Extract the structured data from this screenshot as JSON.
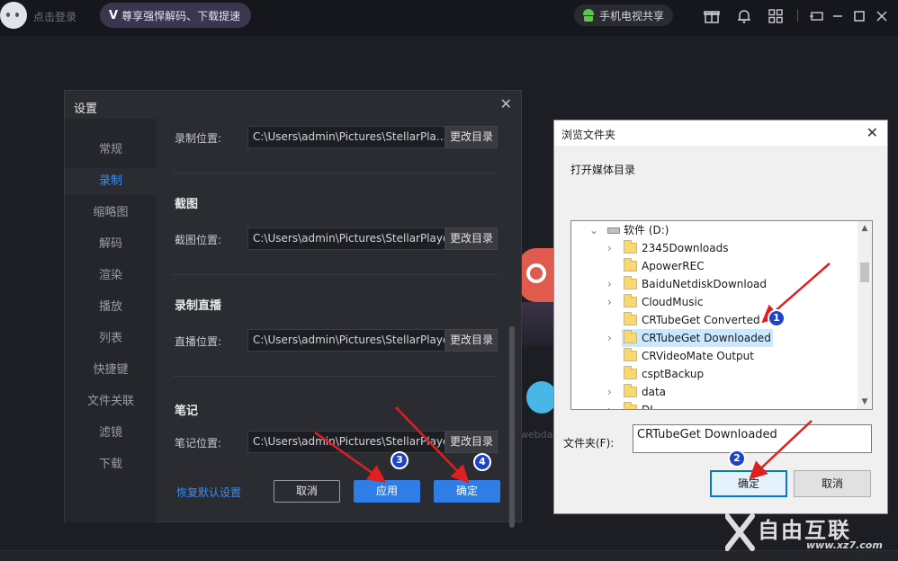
{
  "topbar": {
    "login": "点击登录",
    "vip_prefix": "V",
    "vip_text": "尊享强悍解码、下载提速",
    "share": "手机电视共享"
  },
  "background": {
    "partial_text": "webda"
  },
  "settings": {
    "title": "设置",
    "sidebar": [
      "常规",
      "录制",
      "缩略图",
      "解码",
      "渲染",
      "播放",
      "列表",
      "快捷键",
      "文件关联",
      "滤镜",
      "下载"
    ],
    "active_index": 1,
    "record_label": "录制位置:",
    "record_path": "C:\\Users\\admin\\Pictures\\StellarPla...",
    "screenshot_title": "截图",
    "screenshot_label": "截图位置:",
    "screenshot_path": "C:\\Users\\admin\\Pictures\\StellarPlayer",
    "live_title": "录制直播",
    "live_label": "直播位置:",
    "live_path": "C:\\Users\\admin\\Pictures\\StellarPlayer",
    "notes_title": "笔记",
    "notes_label": "笔记位置:",
    "notes_path": "C:\\Users\\admin\\Pictures\\StellarPlayer",
    "change_dir": "更改目录",
    "restore_default": "恢复默认设置",
    "cancel": "取消",
    "apply": "应用",
    "ok": "确定"
  },
  "browse": {
    "title": "浏览文件夹",
    "description": "打开媒体目录",
    "tree": [
      {
        "label": "软件 (D:)",
        "type": "drive",
        "expanded": true
      },
      {
        "label": "2345Downloads",
        "type": "folder",
        "children": true
      },
      {
        "label": "ApowerREC",
        "type": "folder",
        "children": false
      },
      {
        "label": "BaiduNetdiskDownload",
        "type": "folder",
        "children": true
      },
      {
        "label": "CloudMusic",
        "type": "folder",
        "children": true
      },
      {
        "label": "CRTubeGet Converted",
        "type": "folder",
        "children": false
      },
      {
        "label": "CRTubeGet Downloaded",
        "type": "folder",
        "children": true,
        "selected": true
      },
      {
        "label": "CRVideoMate Output",
        "type": "folder",
        "children": false
      },
      {
        "label": "csptBackup",
        "type": "folder",
        "children": false
      },
      {
        "label": "data",
        "type": "folder",
        "children": true
      },
      {
        "label": "DL...",
        "type": "folder",
        "children": true
      }
    ],
    "folder_label": "文件夹(F):",
    "folder_value": "CRTubeGet Downloaded",
    "ok": "确定",
    "cancel": "取消"
  },
  "annotations": [
    "1",
    "2",
    "3",
    "4"
  ],
  "watermark": {
    "text": "自由互联",
    "url": "www.xz7.com"
  },
  "colors": {
    "accent": "#2f7de6",
    "badge": "#1c43c9",
    "arrow": "#e02020"
  }
}
